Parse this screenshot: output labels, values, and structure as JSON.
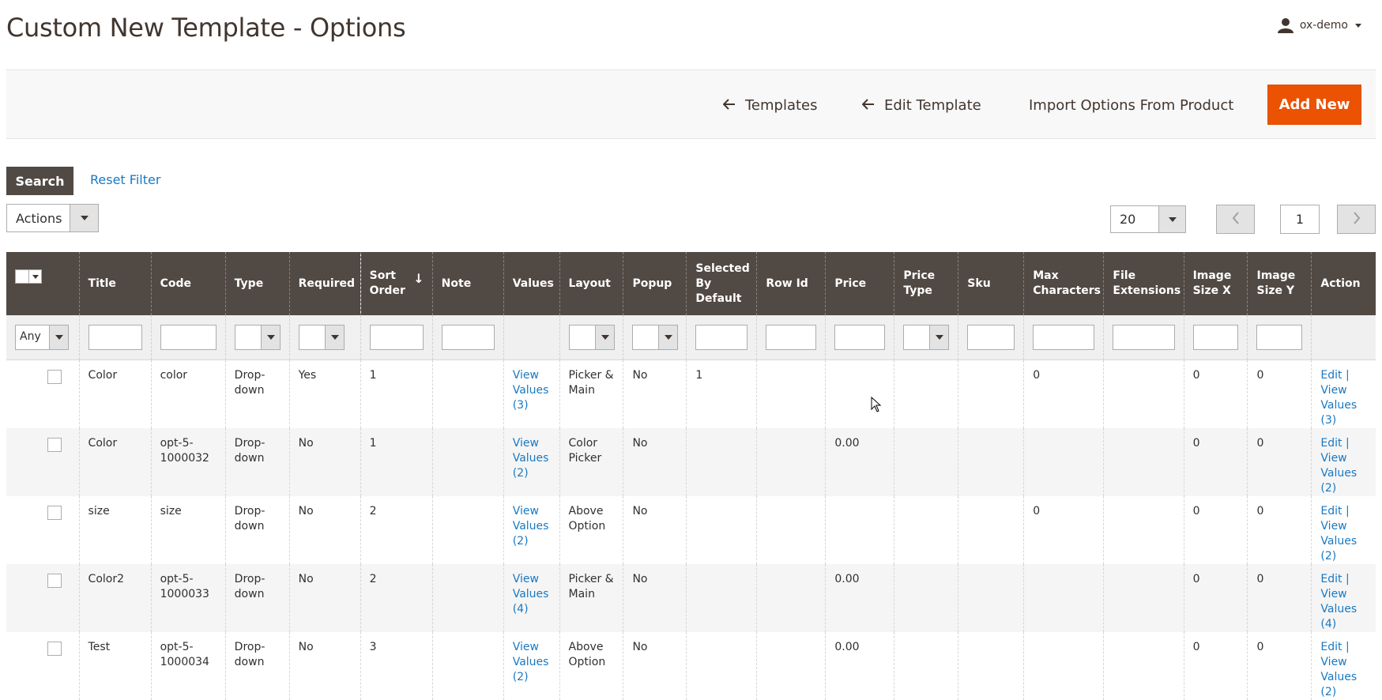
{
  "page": {
    "title": "Custom New Template - Options"
  },
  "user": {
    "name": "ox-demo"
  },
  "toolbar": {
    "templates_label": "Templates",
    "edit_template_label": "Edit Template",
    "import_label": "Import Options From Product",
    "add_new_label": "Add New"
  },
  "filters": {
    "search_label": "Search",
    "reset_label": "Reset Filter",
    "actions_label": "Actions",
    "per_page": "20",
    "current_page": "1",
    "mass_select_value": "Any"
  },
  "grid": {
    "columns": [
      "Title",
      "Code",
      "Type",
      "Required",
      "Sort Order",
      "Note",
      "Values",
      "Layout",
      "Popup",
      "Selected By Default",
      "Row Id",
      "Price",
      "Price Type",
      "Sku",
      "Max Characters",
      "File Extensions",
      "Image Size X",
      "Image Size Y",
      "Action"
    ],
    "sort_indicator": "↓",
    "rows": [
      {
        "title": "Color",
        "code": "color",
        "type": "Drop-down",
        "required": "Yes",
        "sort_order": "1",
        "note": "",
        "values": "View Values (3)",
        "layout": "Picker & Main",
        "popup": "No",
        "selected_by_default": "1",
        "row_id": "",
        "price": "",
        "price_type": "",
        "sku": "",
        "max_characters": "0",
        "file_extensions": "",
        "image_size_x": "0",
        "image_size_y": "0",
        "action_edit": "Edit",
        "action_sep": "|",
        "action_view": "View Values (3)"
      },
      {
        "title": "Color",
        "code": "opt-5-1000032",
        "type": "Drop-down",
        "required": "No",
        "sort_order": "1",
        "note": "",
        "values": "View Values (2)",
        "layout": "Color Picker",
        "popup": "No",
        "selected_by_default": "",
        "row_id": "",
        "price": "0.00",
        "price_type": "",
        "sku": "",
        "max_characters": "",
        "file_extensions": "",
        "image_size_x": "0",
        "image_size_y": "0",
        "action_edit": "Edit",
        "action_sep": "|",
        "action_view": "View Values (2)"
      },
      {
        "title": "size",
        "code": "size",
        "type": "Drop-down",
        "required": "No",
        "sort_order": "2",
        "note": "",
        "values": "View Values (2)",
        "layout": "Above Option",
        "popup": "No",
        "selected_by_default": "",
        "row_id": "",
        "price": "",
        "price_type": "",
        "sku": "",
        "max_characters": "0",
        "file_extensions": "",
        "image_size_x": "0",
        "image_size_y": "0",
        "action_edit": "Edit",
        "action_sep": "|",
        "action_view": "View Values (2)"
      },
      {
        "title": "Color2",
        "code": "opt-5-1000033",
        "type": "Drop-down",
        "required": "No",
        "sort_order": "2",
        "note": "",
        "values": "View Values (4)",
        "layout": "Picker & Main",
        "popup": "No",
        "selected_by_default": "",
        "row_id": "",
        "price": "0.00",
        "price_type": "",
        "sku": "",
        "max_characters": "",
        "file_extensions": "",
        "image_size_x": "0",
        "image_size_y": "0",
        "action_edit": "Edit",
        "action_sep": "|",
        "action_view": "View Values (4)"
      },
      {
        "title": "Test",
        "code": "opt-5-1000034",
        "type": "Drop-down",
        "required": "No",
        "sort_order": "3",
        "note": "",
        "values": "View Values (2)",
        "layout": "Above Option",
        "popup": "No",
        "selected_by_default": "",
        "row_id": "",
        "price": "0.00",
        "price_type": "",
        "sku": "",
        "max_characters": "",
        "file_extensions": "",
        "image_size_x": "0",
        "image_size_y": "0",
        "action_edit": "Edit",
        "action_sep": "|",
        "action_view": "View Values (2)"
      }
    ]
  },
  "colors": {
    "accent": "#eb5202",
    "header_bg": "#514943",
    "link": "#1979c3",
    "title": "#41362f"
  },
  "icons": {
    "user": "user-icon",
    "back": "arrow-left-icon",
    "dropdown": "chevron-down-icon",
    "prev": "chevron-left-icon",
    "next": "chevron-right-icon",
    "cursor": "mouse-pointer-icon"
  }
}
